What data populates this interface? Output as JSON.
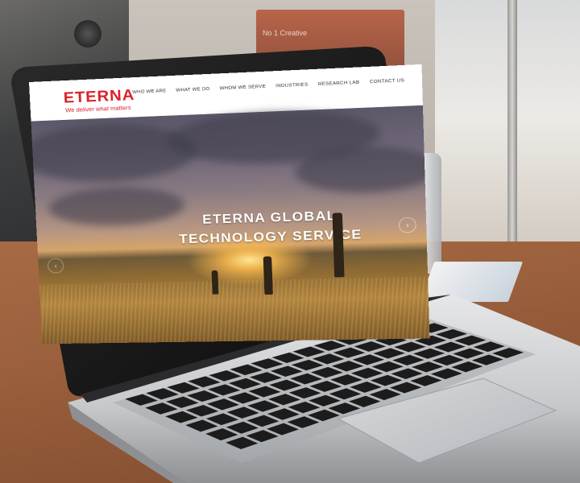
{
  "background": {
    "sign_text": "No 1 Creative"
  },
  "website": {
    "logo": "ETERNA",
    "tagline": "We deliver what matters",
    "nav": [
      {
        "label": "WHO WE ARE"
      },
      {
        "label": "WHAT WE DO"
      },
      {
        "label": "WHOM WE SERVE"
      },
      {
        "label": "INDUSTRIES"
      },
      {
        "label": "RESEARCH LAB"
      },
      {
        "label": "CONTACT US"
      }
    ],
    "hero": {
      "line1": "ETERNA GLOBAL",
      "line2": "TECHNOLOGY SERVICE",
      "next_icon": "›",
      "prev_icon": "‹"
    },
    "brand_color": "#d8222a"
  },
  "colors": {
    "table": "#9a5f3c",
    "laptop_bezel": "#141414",
    "laptop_body": "#c7c9cc",
    "keys": "#1c1c1c"
  }
}
